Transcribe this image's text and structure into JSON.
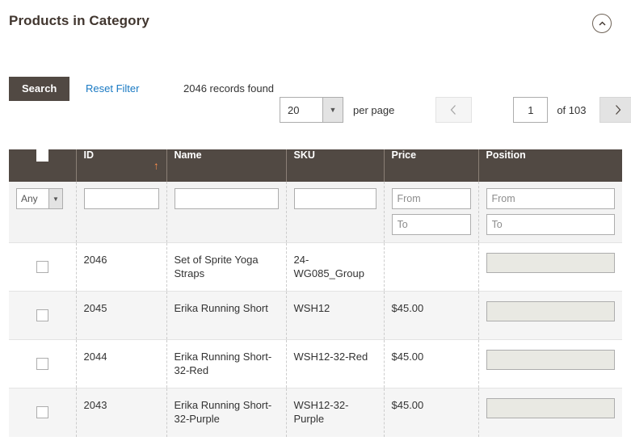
{
  "header": {
    "title": "Products in Category",
    "collapse_icon": "chevron-up-circle-icon"
  },
  "toolbar": {
    "search_label": "Search",
    "reset_filter_label": "Reset Filter",
    "records_found": "2046 records found"
  },
  "pager": {
    "limit_value": "20",
    "per_page_label": "per page",
    "prev_icon": "chevron-left-icon",
    "next_icon": "chevron-right-icon",
    "current_page": "1",
    "of_total": "of 103"
  },
  "grid": {
    "columns": [
      {
        "key": "checkbox",
        "label": ""
      },
      {
        "key": "id",
        "label": "ID",
        "sort": "asc",
        "sort_icon": "↑"
      },
      {
        "key": "name",
        "label": "Name"
      },
      {
        "key": "sku",
        "label": "SKU"
      },
      {
        "key": "price",
        "label": "Price"
      },
      {
        "key": "position",
        "label": "Position"
      }
    ],
    "filters": {
      "checkbox_select": "Any",
      "id_value": "",
      "name_value": "",
      "sku_value": "",
      "price_from_placeholder": "From",
      "price_to_placeholder": "To",
      "position_from_placeholder": "From",
      "position_to_placeholder": "To"
    },
    "rows": [
      {
        "id": "2046",
        "name": "Set of Sprite Yoga Straps",
        "sku": "24-WG085_Group",
        "price": "",
        "position": ""
      },
      {
        "id": "2045",
        "name": "Erika Running Short",
        "sku": "WSH12",
        "price": "$45.00",
        "position": ""
      },
      {
        "id": "2044",
        "name": "Erika Running Short-32-Red",
        "sku": "WSH12-32-Red",
        "price": "$45.00",
        "position": ""
      },
      {
        "id": "2043",
        "name": "Erika Running Short-32-Purple",
        "sku": "WSH12-32-Purple",
        "price": "$45.00",
        "position": ""
      }
    ]
  },
  "colors": {
    "header_bar": "#514943",
    "accent_link": "#1979c3",
    "sort_arrow": "#ff8f4c",
    "row_alt": "#f5f5f5",
    "position_field": "#e9e9e3"
  }
}
